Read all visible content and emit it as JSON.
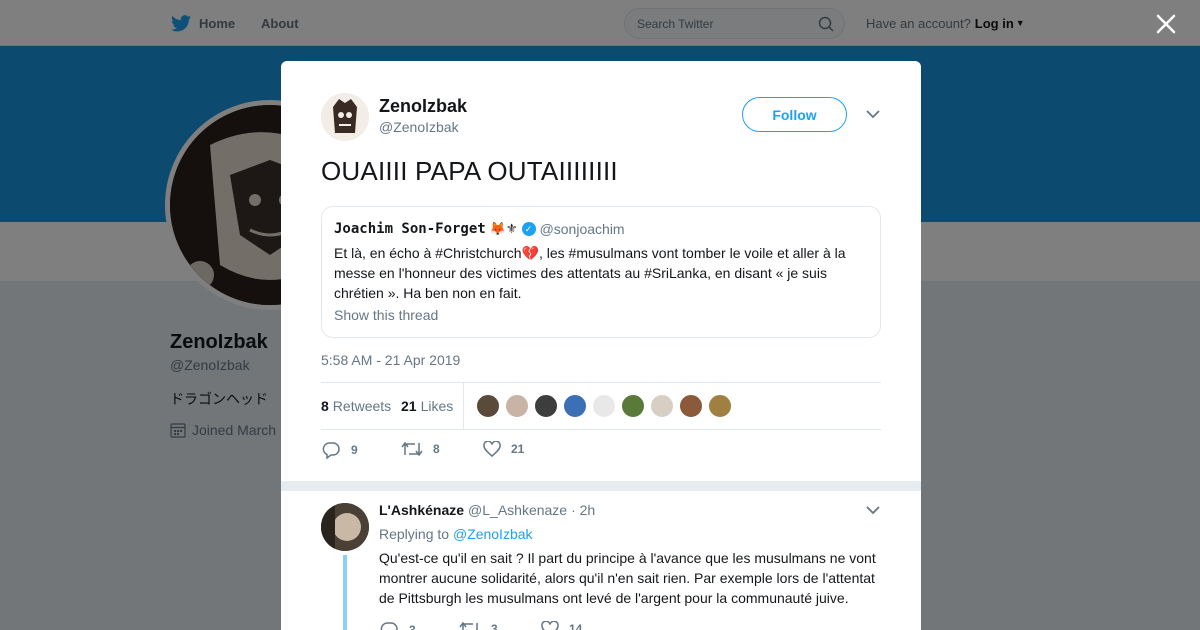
{
  "topbar": {
    "home_label": "Home",
    "about_label": "About",
    "search_placeholder": "Search Twitter",
    "account_prompt": "Have an account?",
    "login_label": "Log in"
  },
  "profile": {
    "name": "ZenoIzbak",
    "handle": "@ZenoIzbak",
    "bio": "ドラゴンヘッド",
    "joined": "Joined March"
  },
  "tweet": {
    "author_name": "ZenoIzbak",
    "author_handle": "@ZenoIzbak",
    "follow_label": "Follow",
    "text": "OUAIIII PAPA OUTAIIIIIIII",
    "timestamp": "5:58 AM - 21 Apr 2019",
    "retweets_count": "8",
    "retweets_label": "Retweets",
    "likes_count": "21",
    "likes_label": "Likes",
    "reply_action_count": "9",
    "retweet_action_count": "8",
    "like_action_count": "21",
    "liker_colors": [
      "#5a4a3a",
      "#c9b2a6",
      "#3d3d3d",
      "#3b6fb6",
      "#e8e8e8",
      "#5a7a3a",
      "#d8cfc4",
      "#8a5a3a",
      "#a08040"
    ]
  },
  "quote": {
    "name": "Joachim Son-Forget",
    "emojis": "🦊⚜",
    "handle": "@sonjoachim",
    "text": "Et là, en écho à #Christchurch💔, les #musulmans vont tomber le voile et aller à la messe en l'honneur des victimes des attentats au #SriLanka, en disant « je suis chrétien ». Ha ben non en fait.",
    "thread_link": "Show this thread"
  },
  "reply": {
    "name": "L'Ashkénaze",
    "handle": "@L_Ashkenaze",
    "time": "· 2h",
    "replying_prefix": "Replying to",
    "replying_to": "@ZenoIzbak",
    "text": "Qu'est-ce qu'il en sait ? Il part du principe à l'avance que les musulmans ne vont montrer aucune solidarité, alors qu'il n'en sait rien. Par exemple lors de l'attentat de Pittsburgh les musulmans ont levé de l'argent pour la communauté juive.",
    "reply_count": "3",
    "retweet_count": "3",
    "like_count": "14"
  },
  "colors": {
    "brand": "#1da1f2",
    "banner": "#1b95e0",
    "text_secondary": "#657786"
  }
}
